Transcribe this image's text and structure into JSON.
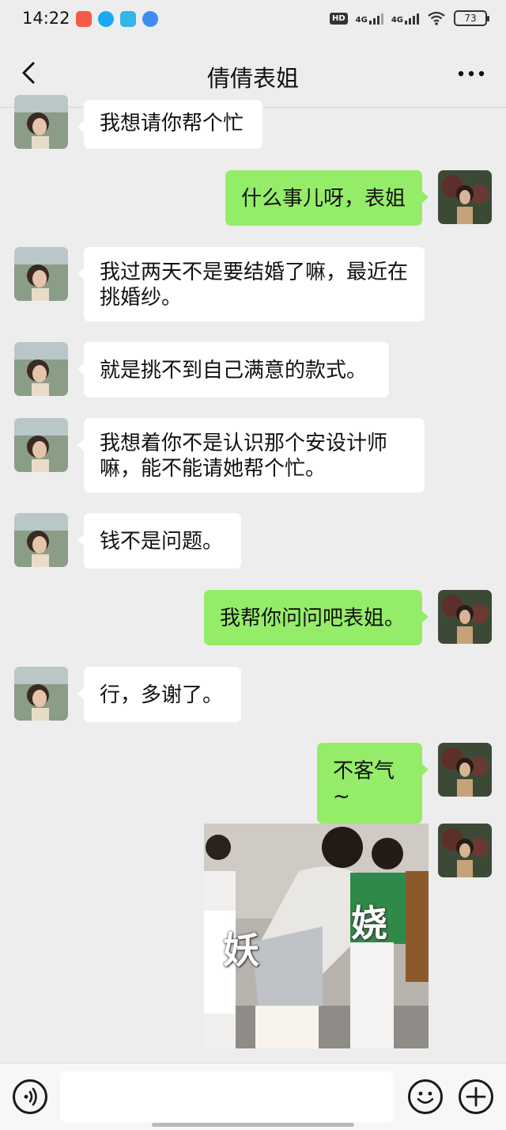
{
  "status": {
    "time": "14:22",
    "hd": "HD",
    "net1": "4G",
    "net2": "4G",
    "battery": "73"
  },
  "header": {
    "title": "倩倩表姐"
  },
  "messages": [
    {
      "side": "in",
      "text": "我想请你帮个忙"
    },
    {
      "side": "out",
      "text": "什么事儿呀，表姐"
    },
    {
      "side": "in",
      "text": "我过两天不是要结婚了嘛，最近在挑婚纱。"
    },
    {
      "side": "in",
      "text": "就是挑不到自己满意的款式。"
    },
    {
      "side": "in",
      "text": "我想着你不是认识那个安设计师嘛，能不能请她帮个忙。"
    },
    {
      "side": "in",
      "text": "钱不是问题。"
    },
    {
      "side": "out",
      "text": "我帮你问问吧表姐。"
    },
    {
      "side": "in",
      "text": "行，多谢了。"
    },
    {
      "side": "out",
      "text": "不客气~"
    }
  ],
  "sticker": {
    "left_char": "妖",
    "right_char": "娆"
  },
  "input": {
    "value": "",
    "placeholder": ""
  },
  "colors": {
    "outgoing_bubble": "#95ec69",
    "incoming_bubble": "#ffffff",
    "background": "#ededed"
  }
}
